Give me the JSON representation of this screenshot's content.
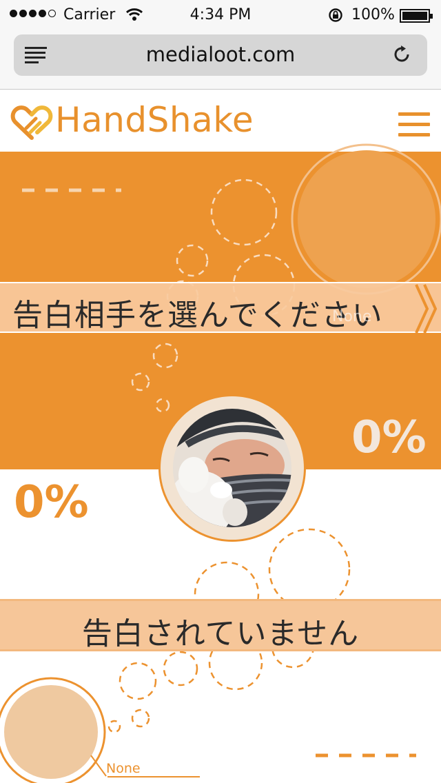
{
  "status_bar": {
    "carrier": "Carrier",
    "time": "4:34 PM",
    "battery": "100%",
    "signal_icon": "signal-dots-icon",
    "wifi_icon": "wifi-icon",
    "lock_icon": "rotation-lock-icon",
    "battery_icon": "battery-icon"
  },
  "browser": {
    "url": "medialoot.com",
    "reader_icon": "reader-icon",
    "reload_icon": "reload-icon"
  },
  "header": {
    "brand": "HandShake",
    "logo_icon": "heart-link-icon",
    "menu_icon": "hamburger-menu-icon"
  },
  "hero": {
    "select_partner_label": "告白相手を選んでください",
    "ghost_label": "None",
    "right_percent": "0%",
    "chevron_icon": "double-chevron-right-icon"
  },
  "lower": {
    "left_percent": "0%",
    "status_label": "告白されていません",
    "none_label": "None"
  },
  "colors": {
    "accent": "#ec922f",
    "banner": "#f6c699",
    "light_circle": "#efc9a0",
    "status_bar_bg": "#f7f7f7"
  }
}
